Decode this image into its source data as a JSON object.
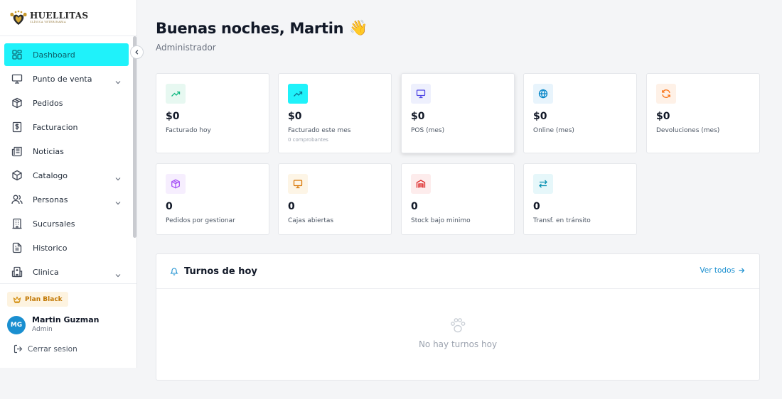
{
  "brand": {
    "name": "HUELLITAS",
    "tagline": "CLÍNICA VETERINARIA"
  },
  "sidebar": {
    "items": [
      {
        "label": "Dashboard",
        "icon": "grid-icon",
        "active": true,
        "expandable": false
      },
      {
        "label": "Punto de venta",
        "icon": "monitor-icon",
        "active": false,
        "expandable": true
      },
      {
        "label": "Pedidos",
        "icon": "package-icon",
        "active": false,
        "expandable": false
      },
      {
        "label": "Facturacion",
        "icon": "dollar-receipt-icon",
        "active": false,
        "expandable": false
      },
      {
        "label": "Noticias",
        "icon": "newspaper-icon",
        "active": false,
        "expandable": false
      },
      {
        "label": "Catalogo",
        "icon": "box-icon",
        "active": false,
        "expandable": true
      },
      {
        "label": "Personas",
        "icon": "users-icon",
        "active": false,
        "expandable": true
      },
      {
        "label": "Sucursales",
        "icon": "building-icon",
        "active": false,
        "expandable": false
      },
      {
        "label": "Historico",
        "icon": "file-text-icon",
        "active": false,
        "expandable": false
      },
      {
        "label": "Clinica",
        "icon": "hospital-icon",
        "active": false,
        "expandable": true
      }
    ],
    "plan": {
      "label": "Plan Black",
      "icon": "crown-icon"
    },
    "user": {
      "initials": "MG",
      "name": "Martin Guzman",
      "role": "Admin"
    },
    "logout_label": "Cerrar sesion"
  },
  "header": {
    "greeting": "Buenas noches, Martin",
    "emoji": "👋",
    "role": "Administrador"
  },
  "stats": [
    {
      "value": "$0",
      "label": "Facturado hoy",
      "sub": "",
      "icon": "trending-up-icon",
      "icon_color": "#10b981",
      "icon_bg": "#e7f8f1"
    },
    {
      "value": "$0",
      "label": "Facturado este mes",
      "sub": "0 comprobantes",
      "icon": "trending-up-icon",
      "icon_color": "#0e7490",
      "icon_bg": "#1ff2fa"
    },
    {
      "value": "$0",
      "label": "POS (mes)",
      "sub": "",
      "icon": "monitor-icon",
      "icon_color": "#4f46e5",
      "icon_bg": "#eef0fd"
    },
    {
      "value": "$0",
      "label": "Online (mes)",
      "sub": "",
      "icon": "globe-icon",
      "icon_color": "#0284c7",
      "icon_bg": "#e8f4fc"
    },
    {
      "value": "$0",
      "label": "Devoluciones (mes)",
      "sub": "",
      "icon": "refresh-icon",
      "icon_color": "#f97316",
      "icon_bg": "#fef1e7"
    },
    {
      "value": "0",
      "label": "Pedidos por gestionar",
      "sub": "",
      "icon": "package-icon",
      "icon_color": "#a855f7",
      "icon_bg": "#f6eefe"
    },
    {
      "value": "0",
      "label": "Cajas abiertas",
      "sub": "",
      "icon": "monitor-icon",
      "icon_color": "#d97706",
      "icon_bg": "#fdf5e6"
    },
    {
      "value": "0",
      "label": "Stock bajo minimo",
      "sub": "",
      "icon": "warehouse-icon",
      "icon_color": "#dc2626",
      "icon_bg": "#fdecec"
    },
    {
      "value": "0",
      "label": "Transf. en tránsito",
      "sub": "",
      "icon": "transfer-arrows-icon",
      "icon_color": "#0891b2",
      "icon_bg": "#e6f7fa"
    }
  ],
  "turnos": {
    "title": "Turnos de hoy",
    "link": "Ver todos",
    "empty": "No hay turnos hoy"
  },
  "colors": {
    "accent": "#1ff2fa",
    "link": "#1a8fd0",
    "plan": "#c27803"
  }
}
